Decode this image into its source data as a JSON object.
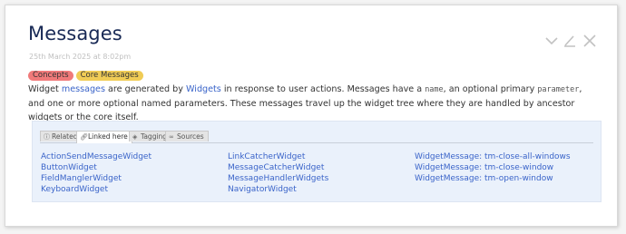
{
  "tiddler": {
    "title": "Messages",
    "subtitle": "25th March 2025 at 8:02pm",
    "tags": [
      {
        "label": "Concepts",
        "color": "#f07a7a"
      },
      {
        "label": "Core Messages",
        "color": "#f0cc56"
      }
    ],
    "controls": [
      "chevron-down-icon",
      "edit-icon",
      "close-icon"
    ],
    "body": {
      "t1": "Widget ",
      "link_messages": "messages",
      "t2": " are generated by ",
      "link_widgets": "Widgets",
      "t3": " in response to user actions. Messages have a ",
      "code_name": "name",
      "t4": ", an optional primary ",
      "code_param": "parameter",
      "t5": ", and one or more optional named parameters. These messages travel up the widget tree where they are handled by ancestor widgets or the core itself."
    }
  },
  "info_panel": {
    "tabs": [
      {
        "label": "Related",
        "icon": "info-icon"
      },
      {
        "label": "Linked here",
        "icon": "link-icon",
        "active": true
      },
      {
        "label": "Tagging",
        "icon": "tag-icon"
      },
      {
        "label": "Sources",
        "icon": "sources-icon"
      }
    ],
    "columns": [
      [
        "ActionSendMessageWidget",
        "ButtonWidget",
        "FieldManglerWidget",
        "KeyboardWidget"
      ],
      [
        "LinkCatcherWidget",
        "MessageCatcherWidget",
        "MessageHandlerWidgets",
        "NavigatorWidget"
      ],
      [
        "WidgetMessage: tm-close-all-windows",
        "WidgetMessage: tm-close-window",
        "WidgetMessage: tm-open-window"
      ]
    ]
  }
}
